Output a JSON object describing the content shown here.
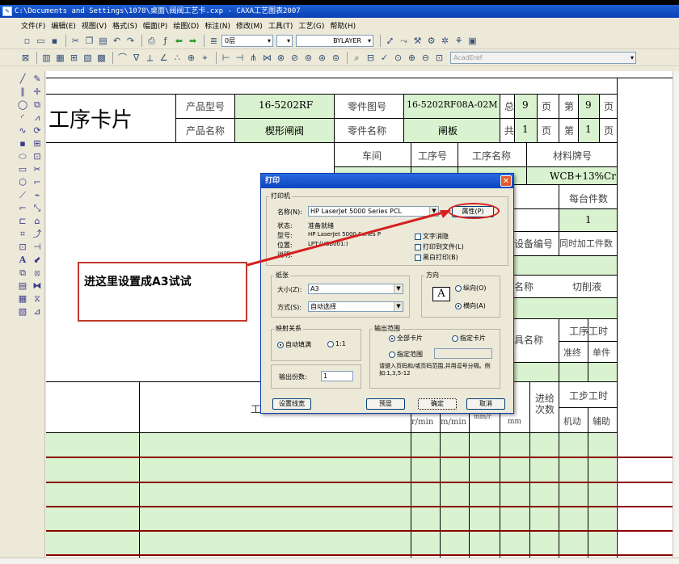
{
  "window": {
    "title": "C:\\Documents and Settings\\1078\\桌面\\阀阀工艺卡.cxp - CAXA工艺图表2007"
  },
  "menu": [
    "文件(F)",
    "编辑(E)",
    "视图(V)",
    "格式(S)",
    "幅面(P)",
    "绘图(D)",
    "标注(N)",
    "修改(M)",
    "工具(T)",
    "工艺(G)",
    "帮助(H)"
  ],
  "toolbar": {
    "layer_value": "0层",
    "linetype_value": "BYLAYER",
    "font_value": "AcadEref"
  },
  "card": {
    "title": "工序卡片",
    "product_model_label": "产品型号",
    "product_model_value": "16-5202RF",
    "part_drawing_no_label": "零件图号",
    "part_drawing_no_value": "16-5202RF08A-02M",
    "total_label": "总",
    "total_value": "9",
    "page_unit_1": "页",
    "sheet_label": "第",
    "sheet_value": "9",
    "page_unit_2": "页",
    "product_name_label": "产品名称",
    "product_name_value": "楔形闸阀",
    "part_name_label": "零件名称",
    "part_name_value": "闸板",
    "total2_label": "共",
    "total2_value": "1",
    "page_unit_3": "页",
    "sheet2_label": "第",
    "sheet2_value": "1",
    "page_unit_4": "页",
    "workshop_label": "车间",
    "process_no_label": "工序号",
    "process_name_label": "工序名称",
    "material_label": "材料牌号",
    "material_value": "WCB+13%Cr",
    "per_blank_label": "每台件数",
    "per_blank_value": "1",
    "equipment_no_label": "设备编号",
    "simultaneous_label": "同时加工件数",
    "fixture_name_label": "名称",
    "coolant_label": "切削液",
    "tool_name_label": "具名称",
    "process_time_label": "工序工时",
    "standard_label": "准终",
    "unit_label": "单件",
    "feed_count_label": "进给次数",
    "step_time_label": "工步工时",
    "machine_label": "机动",
    "aux_label": "辅助",
    "speed_unit": "r/min",
    "cut_speed_unit": "m/min",
    "feed_unit": "mm/r",
    "depth_unit": "mm",
    "step_header_fragment": "工"
  },
  "dialog": {
    "title": "打印",
    "printer_group": "打印机",
    "name_label": "名称(N):",
    "name_value": "HP LaserJet 5000 Series PCL",
    "properties_button": "属性(P)",
    "status_label": "状态:",
    "status_value": "准备就绪",
    "type_label": "型号:",
    "type_value": "HP LaserJet 5000 Series P",
    "location_label": "位置:",
    "location_value": "LPT:(USB001:)",
    "comment_label": "说明:",
    "text_vector_label": "文字消隐",
    "print_to_file_label": "打印到文件(L)",
    "black_white_label": "黑白打印(B)",
    "paper_group": "纸张",
    "size_label": "大小(Z):",
    "size_value": "A3",
    "source_label": "方式(S):",
    "source_value": "自动选择",
    "orientation_group": "方向",
    "portrait_label": "纵向(O)",
    "landscape_label": "横向(A)",
    "orientation_glyph": "A",
    "mapping_group": "映射关系",
    "auto_fill_label": "自动填满",
    "one_to_one_label": "1:1",
    "copies_label": "输出份数:",
    "copies_value": "1",
    "range_group": "输出范围",
    "all_cards_label": "全部卡片",
    "selected_cards_label": "指定卡片",
    "specified_range_label": "指定范围",
    "range_hint": "请键入页码和/或页码范围,并用逗号分隔。例如:1,3,5-12",
    "preview_button": "设置线宽",
    "preview2_button": "预显",
    "ok_button": "确定",
    "cancel_button": "取消"
  },
  "annotation": {
    "text": "进这里设置成A3试试"
  }
}
